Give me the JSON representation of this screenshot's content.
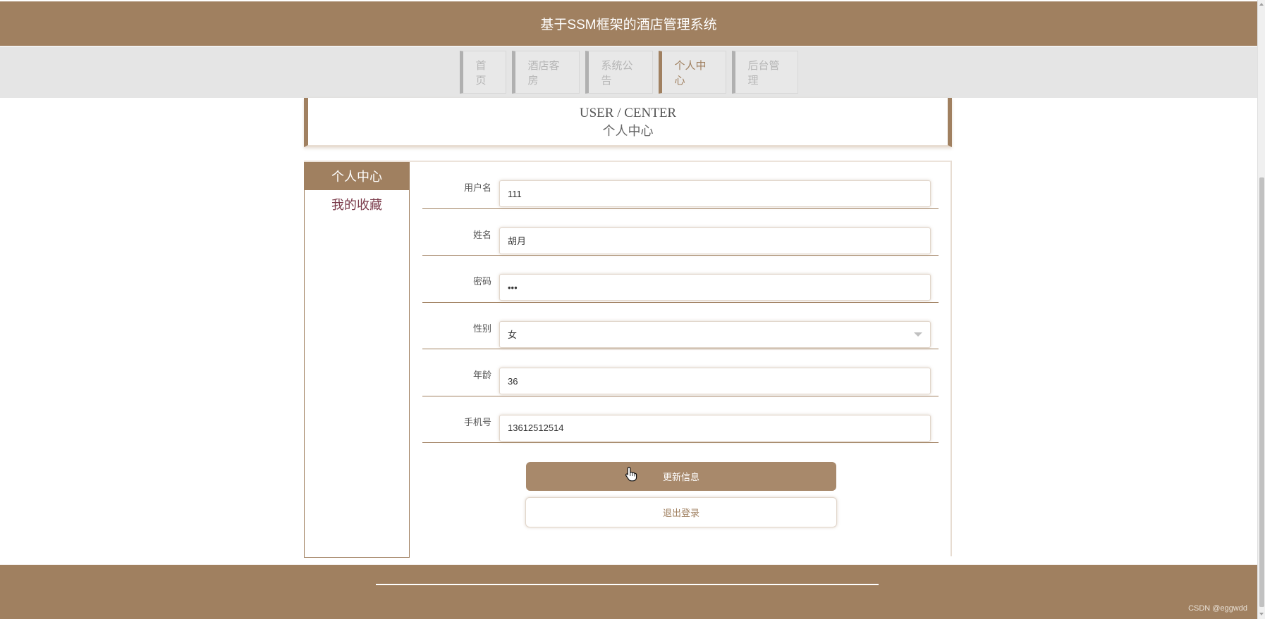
{
  "header": {
    "title": "基于SSM框架的酒店管理系统"
  },
  "nav": {
    "items": [
      {
        "label": "首页"
      },
      {
        "label": "酒店客房"
      },
      {
        "label": "系统公告"
      },
      {
        "label": "个人中心",
        "active": true
      },
      {
        "label": "后台管理"
      }
    ]
  },
  "banner": {
    "en": "USER / CENTER",
    "cn": "个人中心"
  },
  "sidebar": {
    "items": [
      {
        "label": "个人中心",
        "active": true
      },
      {
        "label": "我的收藏"
      }
    ]
  },
  "form": {
    "username": {
      "label": "用户名",
      "value": "111"
    },
    "name": {
      "label": "姓名",
      "value": "胡月"
    },
    "password": {
      "label": "密码",
      "value": "•••"
    },
    "gender": {
      "label": "性别",
      "value": "女"
    },
    "age": {
      "label": "年龄",
      "value": "36"
    },
    "phone": {
      "label": "手机号",
      "value": "13612512514"
    }
  },
  "buttons": {
    "update": "更新信息",
    "logout": "退出登录"
  },
  "watermark": "CSDN @eggwdd",
  "colors": {
    "brand": "#a08060",
    "button": "#a8896b",
    "sidebar_text": "#7a3a4a"
  }
}
